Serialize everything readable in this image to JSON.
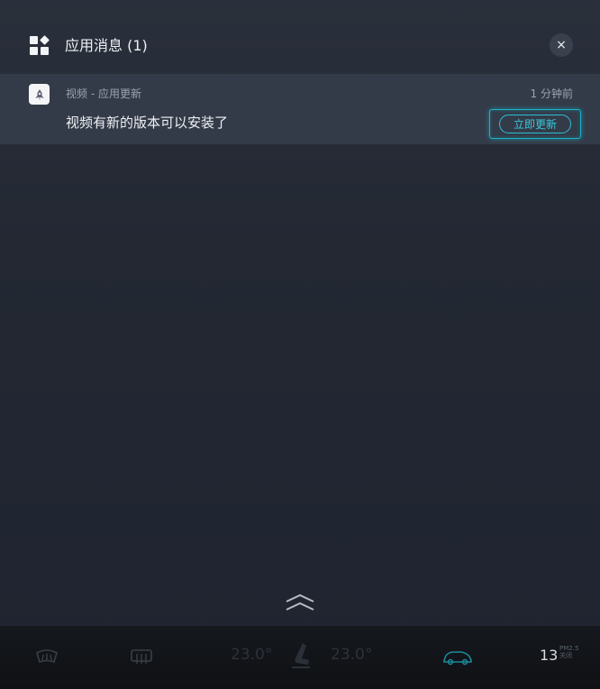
{
  "header": {
    "title": "应用消息 (1)",
    "close_label": "×"
  },
  "notification": {
    "source": "视频 - 应用更新",
    "time": "1 分钟前",
    "message": "视频有新的版本可以安装了",
    "action_label": "立即更新",
    "accent_color": "#27c0d6"
  },
  "climate": {
    "left_temp": "23.0°",
    "right_temp": "23.0°",
    "aqi_value": "13",
    "aqi_label": "PM2.5",
    "aqi_status": "关闭"
  },
  "icons": [
    "apps-icon",
    "close-icon",
    "video-app-icon",
    "chevron-up-icon",
    "front-defrost-icon",
    "rear-defrost-icon",
    "seat-icon",
    "car-icon"
  ]
}
